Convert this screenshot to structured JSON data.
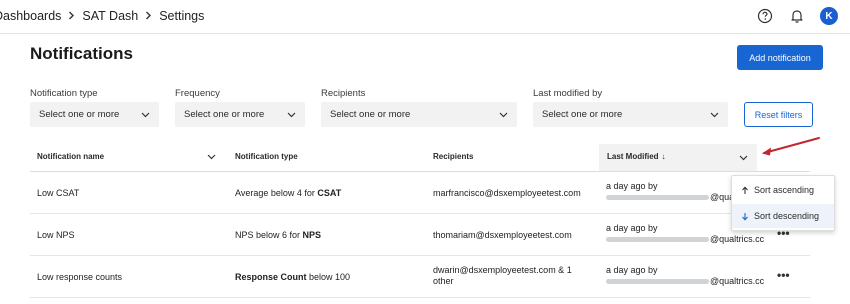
{
  "breadcrumb": {
    "items": [
      "Dashboards",
      "SAT Dash",
      "Settings"
    ]
  },
  "header": {
    "avatar_initial": "K"
  },
  "page": {
    "title": "Notifications",
    "add_button": "Add notification"
  },
  "filters": {
    "items": [
      {
        "label": "Notification type",
        "value": "Select one or more"
      },
      {
        "label": "Frequency",
        "value": "Select one or more"
      },
      {
        "label": "Recipients",
        "value": "Select one or more"
      },
      {
        "label": "Last modified by",
        "value": "Select one or more"
      }
    ],
    "reset_button": "Reset filters"
  },
  "table": {
    "columns": [
      "Notification name",
      "Notification type",
      "Recipients",
      "Last Modified"
    ],
    "sort_indicator": "↓",
    "rows": [
      {
        "name": "Low CSAT",
        "type_pre": "Average below 4 for ",
        "type_bold": "CSAT",
        "type_post": "",
        "recipients_line1": "marfrancisco@dsxemployeetest.com",
        "recipients_line2": "",
        "modified_line1": "a day ago by",
        "modified_line2": "@qualt",
        "more": "•••"
      },
      {
        "name": "Low NPS",
        "type_pre": "NPS below 6 for ",
        "type_bold": "NPS",
        "type_post": "",
        "recipients_line1": "thomariam@dsxemployeetest.com",
        "recipients_line2": "",
        "modified_line1": "a day ago by",
        "modified_line2": "@qualtrics.cc",
        "more": "•••"
      },
      {
        "name": "Low response counts",
        "type_pre": "",
        "type_bold": "Response Count",
        "type_post": " below 100",
        "recipients_line1": "dwarin@dsxemployeetest.com & 1",
        "recipients_line2": "other",
        "modified_line1": "a day ago by",
        "modified_line2": "@qualtrics.cc",
        "more": "•••"
      }
    ]
  },
  "sort_menu": {
    "ascending": "Sort ascending",
    "descending": "Sort descending",
    "active": "descending"
  },
  "colors": {
    "primary": "#1866d4",
    "annotation_arrow": "#c0282d",
    "select_bg": "#f2f2f3"
  }
}
